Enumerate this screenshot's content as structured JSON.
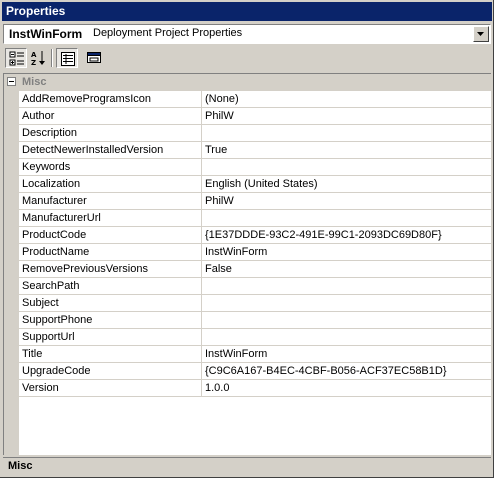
{
  "window": {
    "title": "Properties"
  },
  "selector": {
    "object_name": "InstWinForm",
    "object_type": "Deployment Project Properties"
  },
  "toolbar": {
    "categorized": "categorized-icon",
    "alphabetical": "alphabetical-icon",
    "properties": "properties-icon",
    "property_pages": "property-pages-icon"
  },
  "category": {
    "label": "Misc",
    "expanded": true
  },
  "properties": [
    {
      "name": "AddRemoveProgramsIcon",
      "value": "(None)"
    },
    {
      "name": "Author",
      "value": "PhilW"
    },
    {
      "name": "Description",
      "value": ""
    },
    {
      "name": "DetectNewerInstalledVersion",
      "value": "True"
    },
    {
      "name": "Keywords",
      "value": ""
    },
    {
      "name": "Localization",
      "value": "English (United States)"
    },
    {
      "name": "Manufacturer",
      "value": "PhilW"
    },
    {
      "name": "ManufacturerUrl",
      "value": ""
    },
    {
      "name": "ProductCode",
      "value": "{1E37DDDE-93C2-491E-99C1-2093DC69D80F}"
    },
    {
      "name": "ProductName",
      "value": "InstWinForm"
    },
    {
      "name": "RemovePreviousVersions",
      "value": "False"
    },
    {
      "name": "SearchPath",
      "value": ""
    },
    {
      "name": "Subject",
      "value": ""
    },
    {
      "name": "SupportPhone",
      "value": ""
    },
    {
      "name": "SupportUrl",
      "value": ""
    },
    {
      "name": "Title",
      "value": "InstWinForm"
    },
    {
      "name": "UpgradeCode",
      "value": "{C9C6A167-B4EC-4CBF-B056-ACF37EC58B1D}"
    },
    {
      "name": "Version",
      "value": "1.0.0"
    }
  ],
  "description": {
    "title": "Misc"
  },
  "colors": {
    "titlebar": "#0a246a",
    "face": "#d4d0c8",
    "grid_bg": "#ffffff"
  }
}
